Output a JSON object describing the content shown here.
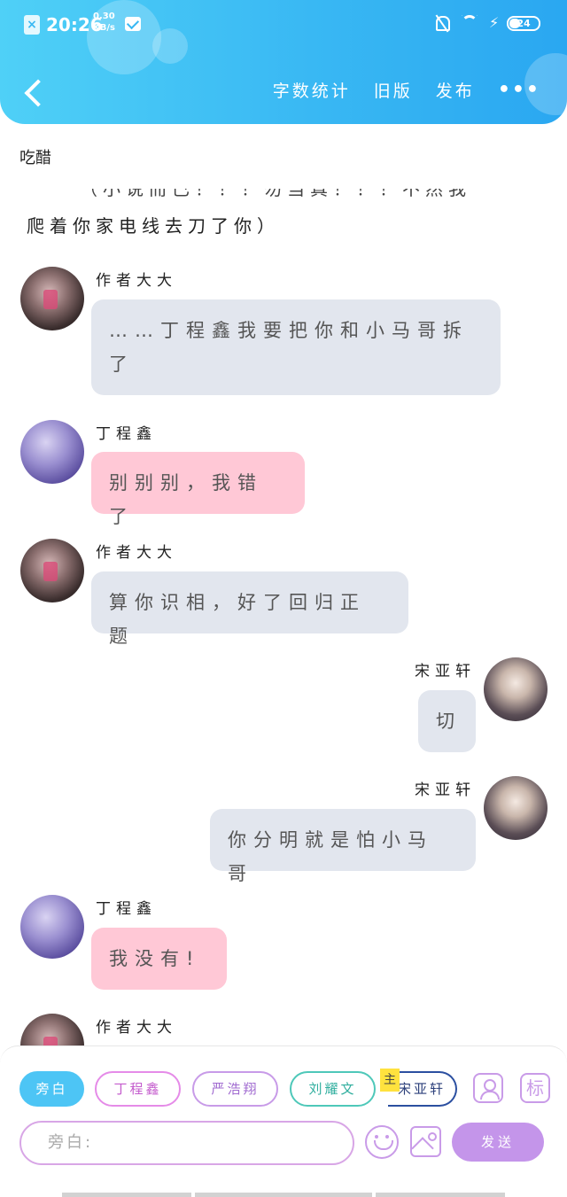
{
  "status_bar": {
    "time": "20:26",
    "net_speed_value": "0.30",
    "net_speed_unit": "KB/s",
    "battery": "24"
  },
  "toolbar": {
    "word_count": "字数统计",
    "old_version": "旧版",
    "publish": "发布",
    "more": "•••"
  },
  "story": {
    "title": "吃醋",
    "narration_cut": "（小说而已！！！勿当真！！！不然我",
    "narration": "爬着你家电线去刀了你）"
  },
  "messages": [
    {
      "speaker": "作者大大",
      "text": "……丁程鑫我要把你和小马哥拆了",
      "side": "left",
      "color": "#e2e6ee"
    },
    {
      "speaker": "丁程鑫",
      "text": "别别别，我错了",
      "side": "left",
      "color": "#ffc8d6"
    },
    {
      "speaker": "作者大大",
      "text": "算你识相，好了回归正题",
      "side": "left",
      "color": "#e2e6ee"
    },
    {
      "speaker": "宋亚轩",
      "text": "切",
      "side": "right",
      "color": "#e2e6ee"
    },
    {
      "speaker": "宋亚轩",
      "text": "你分明就是怕小马哥",
      "side": "right",
      "color": "#e2e6ee"
    },
    {
      "speaker": "丁程鑫",
      "text": "我没有!",
      "side": "left",
      "color": "#ffc8d6"
    },
    {
      "speaker": "作者大大",
      "text": "",
      "side": "left",
      "color": "#e2e6ee"
    }
  ],
  "composer": {
    "roles": [
      "旁白",
      "丁程鑫",
      "严浩翔",
      "刘耀文",
      "宋亚轩"
    ],
    "main_tag": "主",
    "tag_icon": "标",
    "input_placeholder": "旁白:",
    "send": "发送"
  },
  "colors": {
    "header_accent": "#39b8f3",
    "send_button": "#c495ea",
    "narration_chip": "#4dc5f5"
  }
}
